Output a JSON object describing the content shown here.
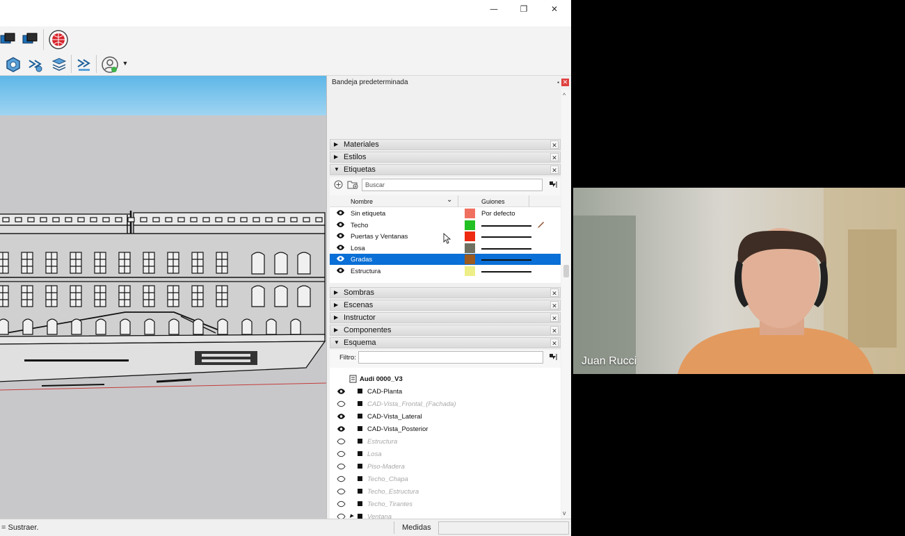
{
  "window": {
    "controls": {
      "minimize": "—",
      "restore": "❐",
      "close": "✕"
    }
  },
  "toolbar": {
    "icons_row1": [
      "layers-icon",
      "layers-alt-icon",
      "geo-location-icon"
    ],
    "icons_row2": [
      "solid-inspector-icon",
      "fix-icon",
      "stack-icon",
      "cleanup-icon",
      "account-icon"
    ]
  },
  "tray": {
    "title": "Bandeja predeterminada",
    "panels_top": [
      {
        "label": "Materiales",
        "expanded": false
      },
      {
        "label": "Estilos",
        "expanded": false
      },
      {
        "label": "Etiquetas",
        "expanded": true
      }
    ],
    "tags": {
      "search_placeholder": "Buscar",
      "col_name": "Nombre",
      "col_dashes": "Guiones",
      "rows": [
        {
          "name": "Sin etiqueta",
          "color": "#f07060",
          "dashes": "Por defecto",
          "visible": true,
          "selected": false
        },
        {
          "name": "Techo",
          "color": "#22c022",
          "dashes": "",
          "visible": true,
          "selected": false
        },
        {
          "name": "Puertas y Ventanas",
          "color": "#ee2a10",
          "dashes": "",
          "visible": true,
          "selected": false
        },
        {
          "name": "Losa",
          "color": "#707060",
          "dashes": "",
          "visible": true,
          "selected": false
        },
        {
          "name": "Gradas",
          "color": "#9a5a20",
          "dashes": "",
          "visible": true,
          "selected": true
        },
        {
          "name": "Estructura",
          "color": "#eeee88",
          "dashes": "",
          "visible": true,
          "selected": false
        }
      ]
    },
    "panels_bottom": [
      {
        "label": "Sombras",
        "expanded": false
      },
      {
        "label": "Escenas",
        "expanded": false
      },
      {
        "label": "Instructor",
        "expanded": false
      },
      {
        "label": "Componentes",
        "expanded": false
      },
      {
        "label": "Esquema",
        "expanded": true
      }
    ],
    "outline": {
      "filter_label": "Filtro:",
      "filter_value": "",
      "root": "Audi 0000_V3",
      "items": [
        {
          "name": "CAD-Planta",
          "visible": true
        },
        {
          "name": "CAD-Vista_Frontal_(Fachada)",
          "visible": false
        },
        {
          "name": "CAD-Vista_Lateral",
          "visible": true
        },
        {
          "name": "CAD-Vista_Posterior",
          "visible": true
        },
        {
          "name": "Estructura",
          "visible": false
        },
        {
          "name": "Losa",
          "visible": false
        },
        {
          "name": "Piso-Madera",
          "visible": false
        },
        {
          "name": "Techo_Chapa",
          "visible": false
        },
        {
          "name": "Techo_Estructura",
          "visible": false
        },
        {
          "name": "Techo_Tirantes",
          "visible": false
        },
        {
          "name": "Ventana",
          "visible": false,
          "has_children": true
        }
      ]
    }
  },
  "statusbar": {
    "hint": "= Sustraer.",
    "measure_label": "Medidas",
    "measure_value": ""
  },
  "webcam": {
    "participant_name": "Juan Rucci"
  }
}
